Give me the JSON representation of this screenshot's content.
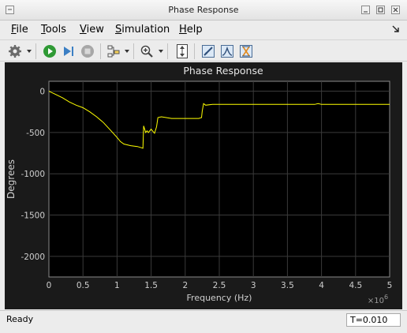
{
  "window": {
    "title": "Phase Response"
  },
  "menu": [
    {
      "mnemonic": "F",
      "rest": "ile"
    },
    {
      "mnemonic": "T",
      "rest": "ools"
    },
    {
      "mnemonic": "V",
      "rest": "iew"
    },
    {
      "mnemonic": "S",
      "rest": "imulation"
    },
    {
      "mnemonic": "H",
      "rest": "elp"
    }
  ],
  "toolbar": {
    "icons": [
      "settings-gear-icon",
      "run-icon",
      "step-forward-icon",
      "stop-icon",
      "signal-select-icon",
      "zoom-in-icon",
      "autoscale-icon",
      "cursor-measure-icon",
      "peak-finder-icon",
      "bilevel-measure-icon"
    ]
  },
  "status": {
    "text": "Ready",
    "time": "T=0.010"
  },
  "colors": {
    "trace": "#ffff00",
    "axes_bg": "#000000",
    "panel_bg": "#1a1a1a",
    "grid": "#3a3a3a"
  },
  "chart_data": {
    "type": "line",
    "title": "Phase Response",
    "xlabel": "Frequency (Hz)",
    "ylabel": "Degrees",
    "x_multiplier": "×10^6",
    "x_exponent_label": "×10",
    "x_exponent_power": "6",
    "xlim": [
      0,
      5
    ],
    "ylim": [
      -2250,
      120
    ],
    "xticks": [
      "0",
      "0.5",
      "1",
      "1.5",
      "2",
      "2.5",
      "3",
      "3.5",
      "4",
      "4.5",
      "5"
    ],
    "yticks": [
      "0",
      "-500",
      "-1000",
      "-1500",
      "-2000"
    ],
    "grid": true,
    "series": [
      {
        "color": "#ffff00",
        "x": [
          0,
          0.1,
          0.2,
          0.3,
          0.4,
          0.5,
          0.6,
          0.7,
          0.8,
          0.9,
          1.0,
          1.05,
          1.1,
          1.2,
          1.3,
          1.38,
          1.39,
          1.42,
          1.44,
          1.46,
          1.5,
          1.55,
          1.58,
          1.6,
          1.65,
          1.8,
          2.0,
          2.2,
          2.24,
          2.25,
          2.27,
          2.3,
          2.4,
          2.6,
          3.0,
          3.5,
          3.9,
          3.95,
          4.0,
          4.5,
          5.0
        ],
        "y": [
          0,
          -40,
          -80,
          -130,
          -170,
          -200,
          -250,
          -310,
          -380,
          -470,
          -560,
          -610,
          -640,
          -660,
          -670,
          -690,
          -420,
          -500,
          -480,
          -500,
          -460,
          -510,
          -430,
          -320,
          -310,
          -330,
          -330,
          -330,
          -320,
          -240,
          -150,
          -170,
          -160,
          -160,
          -160,
          -160,
          -160,
          -150,
          -160,
          -160,
          -160
        ]
      }
    ]
  }
}
